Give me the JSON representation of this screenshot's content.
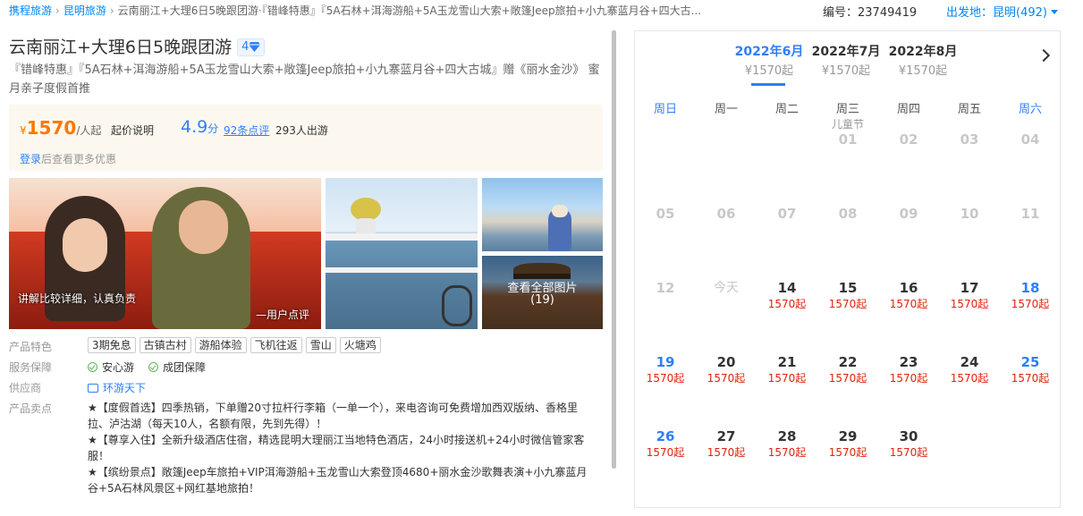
{
  "breadcrumb": {
    "items": [
      "携程旅游",
      "昆明旅游"
    ],
    "current": "云南丽江+大理6日5晚跟团游·『错峰特惠』『5A石林+洱海游船+5A玉龙雪山大索+敞篷Jeep旅拍+小九寨蓝月谷+四大古..."
  },
  "header": {
    "product_id": "编号：23749419",
    "departure": "出发地：昆明(492)"
  },
  "product": {
    "title": "云南丽江+大理6日5晚跟团游",
    "grade": "4",
    "subtitle": "『错峰特惠』『5A石林+洱海游船+5A玉龙雪山大索+敞篷Jeep旅拍+小九寨蓝月谷+四大古城』赠《丽水金沙》 蜜月亲子度假首推"
  },
  "price": {
    "currency": "¥",
    "amount": "1570",
    "unit": "/人起",
    "explain": "起价说明",
    "score": "4.9",
    "score_unit": "分",
    "reviews": "92条点评",
    "travelers": "293人出游",
    "login": "登录",
    "login_suffix": "后查看更多优惠"
  },
  "gallery": {
    "caption_main": "讲解比较详细，认真负责",
    "caption_user": "—用户点评",
    "view_all": "查看全部图片",
    "count": "(19)"
  },
  "info": {
    "features_label": "产品特色",
    "tags": [
      "3期免息",
      "古镇古村",
      "游船体验",
      "飞机往返",
      "雪山",
      "火塘鸡"
    ],
    "service_label": "服务保障",
    "guarantees": [
      "安心游",
      "成团保障"
    ],
    "supplier_label": "供应商",
    "supplier": "环游天下",
    "highlights_label": "产品卖点",
    "highlights": [
      "★【度假首选】四季热销，下单赠20寸拉杆行李箱（一单一个），来电咨询可免费增加西双版纳、香格里拉、泸沽湖（每天10人，名额有限，先到先得）！",
      "★【尊享入住】全新升级酒店住宿，精选昆明大理丽江当地特色酒店，24小时接送机+24小时微信管家客服！",
      "★【缤纷景点】敞篷Jeep车旅拍+VIP洱海游船+玉龙雪山大索登顶4680+丽水金沙歌舞表演+小九寨蓝月谷+5A石林风景区+网红基地旅拍！"
    ]
  },
  "calendar": {
    "months": [
      {
        "label": "2022年6月",
        "price": "¥1570起"
      },
      {
        "label": "2022年7月",
        "price": "¥1570起"
      },
      {
        "label": "2022年8月",
        "price": "¥1570起"
      }
    ],
    "weekdays": [
      "周日",
      "周一",
      "周二",
      "周三",
      "周四",
      "周五",
      "周六"
    ],
    "holiday": "儿童节",
    "today": "今天",
    "day_price": "1570起",
    "days": [
      {
        "d": "01",
        "p": ""
      },
      {
        "d": "02",
        "p": ""
      },
      {
        "d": "03",
        "p": ""
      },
      {
        "d": "04",
        "p": ""
      },
      {
        "d": "05",
        "p": ""
      },
      {
        "d": "06",
        "p": ""
      },
      {
        "d": "07",
        "p": ""
      },
      {
        "d": "08",
        "p": ""
      },
      {
        "d": "09",
        "p": ""
      },
      {
        "d": "10",
        "p": ""
      },
      {
        "d": "11",
        "p": ""
      },
      {
        "d": "12",
        "p": ""
      },
      {
        "d": "今天",
        "p": ""
      },
      {
        "d": "14",
        "p": "1570起"
      },
      {
        "d": "15",
        "p": "1570起"
      },
      {
        "d": "16",
        "p": "1570起"
      },
      {
        "d": "17",
        "p": "1570起"
      },
      {
        "d": "18",
        "p": "1570起"
      },
      {
        "d": "19",
        "p": "1570起"
      },
      {
        "d": "20",
        "p": "1570起"
      },
      {
        "d": "21",
        "p": "1570起"
      },
      {
        "d": "22",
        "p": "1570起"
      },
      {
        "d": "23",
        "p": "1570起"
      },
      {
        "d": "24",
        "p": "1570起"
      },
      {
        "d": "25",
        "p": "1570起"
      },
      {
        "d": "26",
        "p": "1570起"
      },
      {
        "d": "27",
        "p": "1570起"
      },
      {
        "d": "28",
        "p": "1570起"
      },
      {
        "d": "29",
        "p": "1570起"
      },
      {
        "d": "30",
        "p": "1570起"
      }
    ]
  },
  "colors": {
    "brand": "#0086f6",
    "price": "#ff7700",
    "calendar_price": "#e0230e",
    "weekend": "#2d7ff9"
  }
}
